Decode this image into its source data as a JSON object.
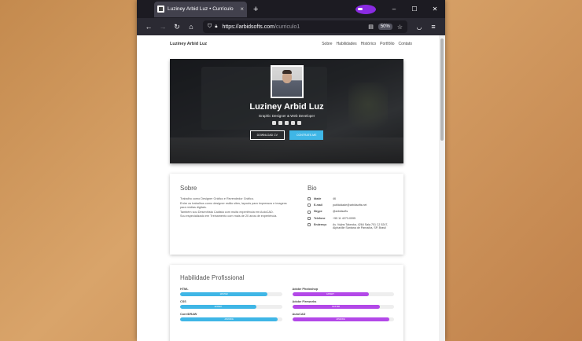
{
  "browser": {
    "tab_title": "Luziney Arbid Luz • Currículo",
    "close_glyph": "×",
    "newtab_glyph": "+",
    "url_host": "https://arbidsofts.com",
    "url_path": "/curriculo1",
    "zoom": "50%",
    "minimize": "–",
    "maximize": "☐",
    "close": "✕",
    "back": "←",
    "forward": "→",
    "reload": "↻",
    "home": "⌂",
    "menu": "≡"
  },
  "site": {
    "brand": "Luziney Arbid Luz",
    "nav": [
      "Sobre",
      "Habilidades",
      "Histórico",
      "Portfólio",
      "Contato"
    ]
  },
  "hero": {
    "name": "Luziney Arbid Luz",
    "role": "Graphic Designer & Web Developer",
    "btn_download": "DOWNLOAD CV",
    "btn_hire": "CONTRATE-ME"
  },
  "about": {
    "title": "Sobre",
    "paragraphs": [
      "Trabalho como Designer Gráfico e Revendedor Gráfico.",
      "Entre os trabalhos como designer estão sites, layouts para impressos e imagens para mídias digitais.",
      "Também sou Desenhista Cadista com muita experiência em AutoCAD.",
      "Sou especializado em Treinamento com mais de 20 anos de experiência."
    ]
  },
  "bio": {
    "title": "Bio",
    "rows": [
      {
        "label": "Idade",
        "value": "46"
      },
      {
        "label": "E-mail",
        "value": "publicidade@arbidsofts.net"
      },
      {
        "label": "Skype",
        "value": "@arbidsofts"
      },
      {
        "label": "Telefone",
        "value": "+55 11 4273-0995"
      },
      {
        "label": "Endereço",
        "value": "Av. Vojins Takeoka, 4264 Sala 701 CJ 5247, Alphaville Santana de Parnaíba, SP, Brasil"
      }
    ]
  },
  "skills": {
    "title": "Habilidade Profissional",
    "left": [
      {
        "name": "HTML",
        "level": "MASTER",
        "percent": 86,
        "color": "#3fb6e6"
      },
      {
        "name": "CSS",
        "level": "EXPERT",
        "percent": 75,
        "color": "#3fb6e6"
      },
      {
        "name": "CorelDRAW",
        "level": "ADVANCE",
        "percent": 96,
        "color": "#3fb6e6"
      }
    ],
    "right": [
      {
        "name": "Adobe Photoshop",
        "level": "EXPERT",
        "percent": 75,
        "color": "#b348e8"
      },
      {
        "name": "Adobe Fireworks",
        "level": "MASTER",
        "percent": 86,
        "color": "#b348e8"
      },
      {
        "name": "AutoCAD",
        "level": "ADVANCE",
        "percent": 95,
        "color": "#b348e8"
      }
    ]
  }
}
